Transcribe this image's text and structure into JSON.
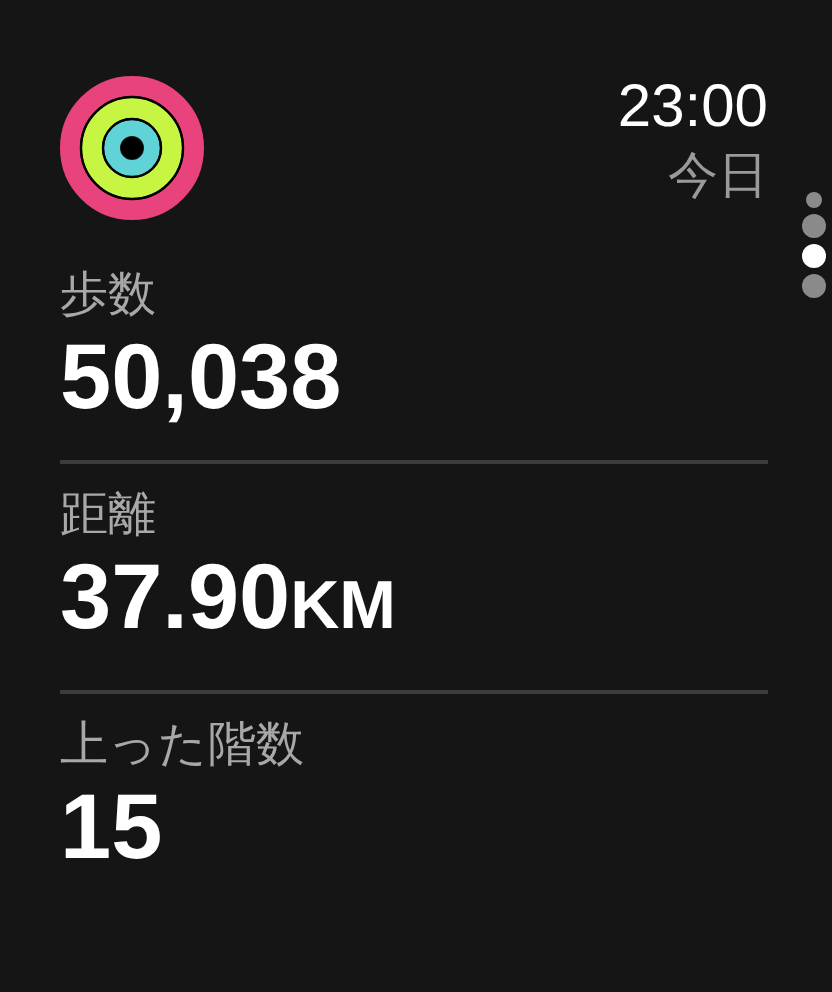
{
  "header": {
    "time": "23:00",
    "day": "今日"
  },
  "pages": [
    {
      "selected": false
    },
    {
      "selected": false
    },
    {
      "selected": true
    },
    {
      "selected": false
    }
  ],
  "metrics": [
    {
      "label": "歩数",
      "value": "50,038"
    },
    {
      "label": "距離",
      "value": "37.90",
      "unit": "KM"
    },
    {
      "label": "上った階数",
      "value": "15"
    }
  ]
}
